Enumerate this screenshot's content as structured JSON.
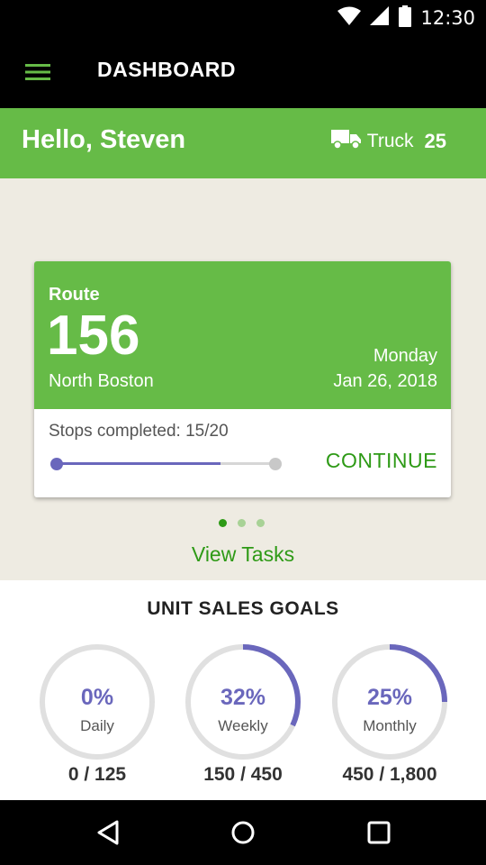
{
  "status": {
    "time": "12:30"
  },
  "app_bar": {
    "title": "DASHBOARD"
  },
  "greeting": {
    "text": "Hello, Steven",
    "truck_label": "Truck",
    "truck_number": "25"
  },
  "route": {
    "label": "Route",
    "number": "156",
    "area": "North Boston",
    "day": "Monday",
    "date": "Jan 26, 2018",
    "stops_text": "Stops completed: 15/20",
    "progress": 0.75,
    "continue_label": "CONTINUE"
  },
  "pager": {
    "count": 3,
    "active": 0
  },
  "view_tasks_label": "View Tasks",
  "goals": {
    "title": "UNIT SALES GOALS",
    "items": [
      {
        "percent_text": "0%",
        "label": "Daily",
        "count": "0 / 125",
        "fraction": 0.0
      },
      {
        "percent_text": "32%",
        "label": "Weekly",
        "count": "150 / 450",
        "fraction": 0.32
      },
      {
        "percent_text": "25%",
        "label": "Monthly",
        "count": "450 / 1,800",
        "fraction": 0.25
      }
    ]
  },
  "colors": {
    "brand_green": "#66bb47",
    "link_green": "#2e9a16",
    "accent_purple": "#6a67bc",
    "track_grey": "#e0e0e0"
  },
  "icons": [
    "wifi-icon",
    "signal-icon",
    "battery-icon",
    "menu-icon",
    "truck-icon",
    "back-icon",
    "home-icon",
    "recents-icon"
  ]
}
